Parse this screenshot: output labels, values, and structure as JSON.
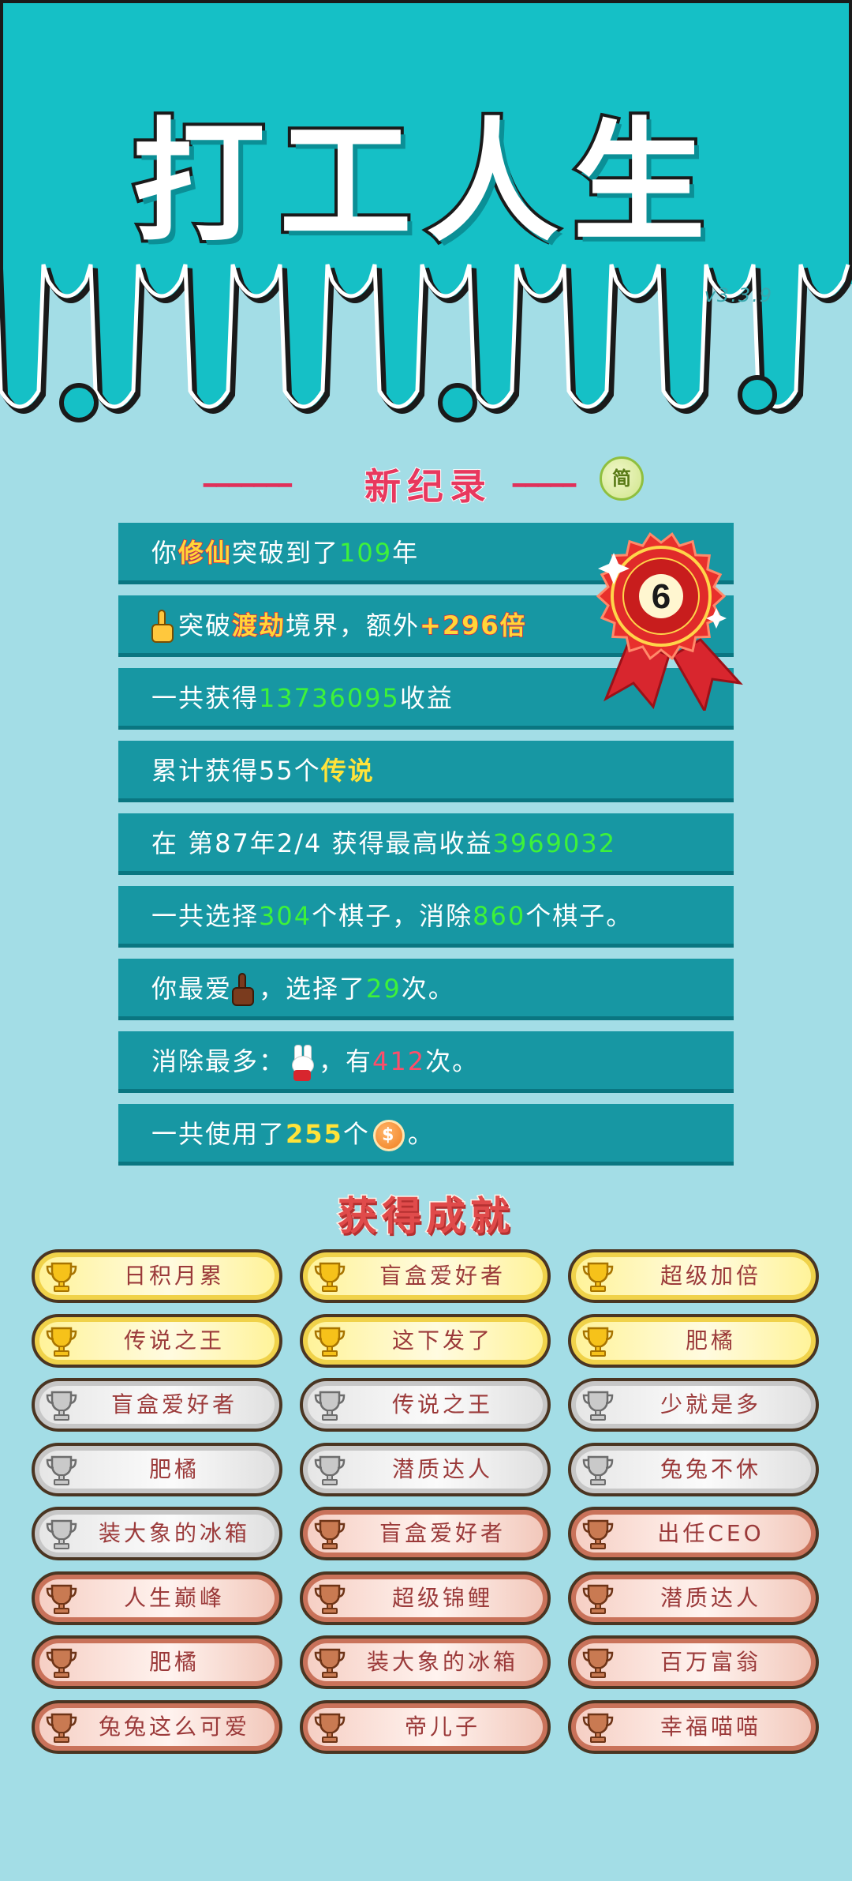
{
  "app": {
    "title": "打工人生",
    "version": "v3.3.9"
  },
  "record": {
    "heading": "新纪录",
    "dash_left": "━━━━━━━",
    "dash_right": "━━━━━",
    "simplified_label": "简",
    "badge_number": "6"
  },
  "rows": [
    {
      "segments": [
        {
          "t": "你"
        },
        {
          "t": "修仙",
          "style": "hl-red"
        },
        {
          "t": "突破到了"
        },
        {
          "t": "109",
          "style": "green"
        },
        {
          "t": "年"
        }
      ]
    },
    {
      "segments": [
        {
          "icon": "pointing-hand-yellow"
        },
        {
          "t": "突破"
        },
        {
          "t": "渡劫",
          "style": "hl-red"
        },
        {
          "t": "境界，额外"
        },
        {
          "t": "+296倍",
          "style": "gold-big"
        }
      ]
    },
    {
      "segments": [
        {
          "t": "一共获得"
        },
        {
          "t": "13736095",
          "style": "green"
        },
        {
          "t": "收益"
        }
      ]
    },
    {
      "segments": [
        {
          "t": "累计获得55个"
        },
        {
          "t": "传说",
          "style": "yellow"
        }
      ]
    },
    {
      "segments": [
        {
          "t": "在 第87年2/4 获得最高收益"
        },
        {
          "t": "3969032",
          "style": "green"
        }
      ]
    },
    {
      "segments": [
        {
          "t": "一共选择"
        },
        {
          "t": "304",
          "style": "green"
        },
        {
          "t": "个棋子，消除"
        },
        {
          "t": "860",
          "style": "green"
        },
        {
          "t": "个棋子。"
        }
      ]
    },
    {
      "segments": [
        {
          "t": "你最爱"
        },
        {
          "icon": "pointing-hand-brown"
        },
        {
          "t": "，选择了"
        },
        {
          "t": "29",
          "style": "green"
        },
        {
          "t": "次。"
        }
      ]
    },
    {
      "segments": [
        {
          "t": "消除最多："
        },
        {
          "icon": "rabbit"
        },
        {
          "t": "，有"
        },
        {
          "t": "412",
          "style": "red"
        },
        {
          "t": "次。"
        }
      ]
    },
    {
      "segments": [
        {
          "t": "一共使用了"
        },
        {
          "t": "255",
          "style": "yellow"
        },
        {
          "t": "个"
        },
        {
          "icon": "coin"
        },
        {
          "t": "。"
        }
      ]
    }
  ],
  "achievements": {
    "heading": "获得成就",
    "items": [
      {
        "label": "日积月累",
        "tier": "gold"
      },
      {
        "label": "盲盒爱好者",
        "tier": "gold"
      },
      {
        "label": "超级加倍",
        "tier": "gold"
      },
      {
        "label": "传说之王",
        "tier": "gold"
      },
      {
        "label": "这下发了",
        "tier": "gold"
      },
      {
        "label": "肥橘",
        "tier": "gold"
      },
      {
        "label": "盲盒爱好者",
        "tier": "silver"
      },
      {
        "label": "传说之王",
        "tier": "silver"
      },
      {
        "label": "少就是多",
        "tier": "silver"
      },
      {
        "label": "肥橘",
        "tier": "silver"
      },
      {
        "label": "潜质达人",
        "tier": "silver"
      },
      {
        "label": "兔兔不休",
        "tier": "silver"
      },
      {
        "label": "装大象的冰箱",
        "tier": "silver"
      },
      {
        "label": "盲盒爱好者",
        "tier": "bronze"
      },
      {
        "label": "出任CEO",
        "tier": "bronze"
      },
      {
        "label": "人生巅峰",
        "tier": "bronze"
      },
      {
        "label": "超级锦鲤",
        "tier": "bronze"
      },
      {
        "label": "潜质达人",
        "tier": "bronze"
      },
      {
        "label": "肥橘",
        "tier": "bronze"
      },
      {
        "label": "装大象的冰箱",
        "tier": "bronze"
      },
      {
        "label": "百万富翁",
        "tier": "bronze"
      },
      {
        "label": "兔兔这么可爱",
        "tier": "bronze"
      },
      {
        "label": "帝儿子",
        "tier": "bronze"
      },
      {
        "label": "幸福喵喵",
        "tier": "bronze"
      }
    ]
  },
  "colors": {
    "header_teal": "#15c0c6",
    "page_bg": "#a3dde6",
    "row_bg": "#1797a3",
    "accent_red": "#e8385e"
  }
}
